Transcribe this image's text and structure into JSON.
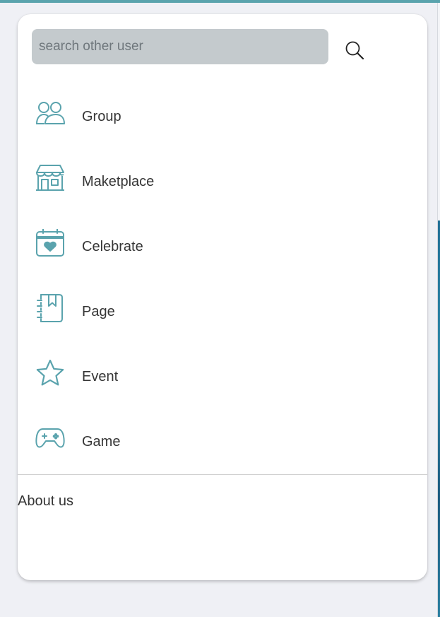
{
  "search": {
    "placeholder": "search other user",
    "value": ""
  },
  "menu": {
    "items": [
      {
        "label": "Group",
        "icon": "group-icon"
      },
      {
        "label": "Maketplace",
        "icon": "store-icon"
      },
      {
        "label": "Celebrate",
        "icon": "calendar-heart-icon"
      },
      {
        "label": "Page",
        "icon": "bookmark-notebook-icon"
      },
      {
        "label": "Event",
        "icon": "star-icon"
      },
      {
        "label": "Game",
        "icon": "gamepad-icon"
      }
    ]
  },
  "footer": {
    "about_label": "About us"
  },
  "colors": {
    "accent": "#5aa3ad",
    "icon": "#5aa3ad",
    "search_bg": "#c4cacd",
    "page_bg": "#eff0f5",
    "text": "#353535"
  }
}
